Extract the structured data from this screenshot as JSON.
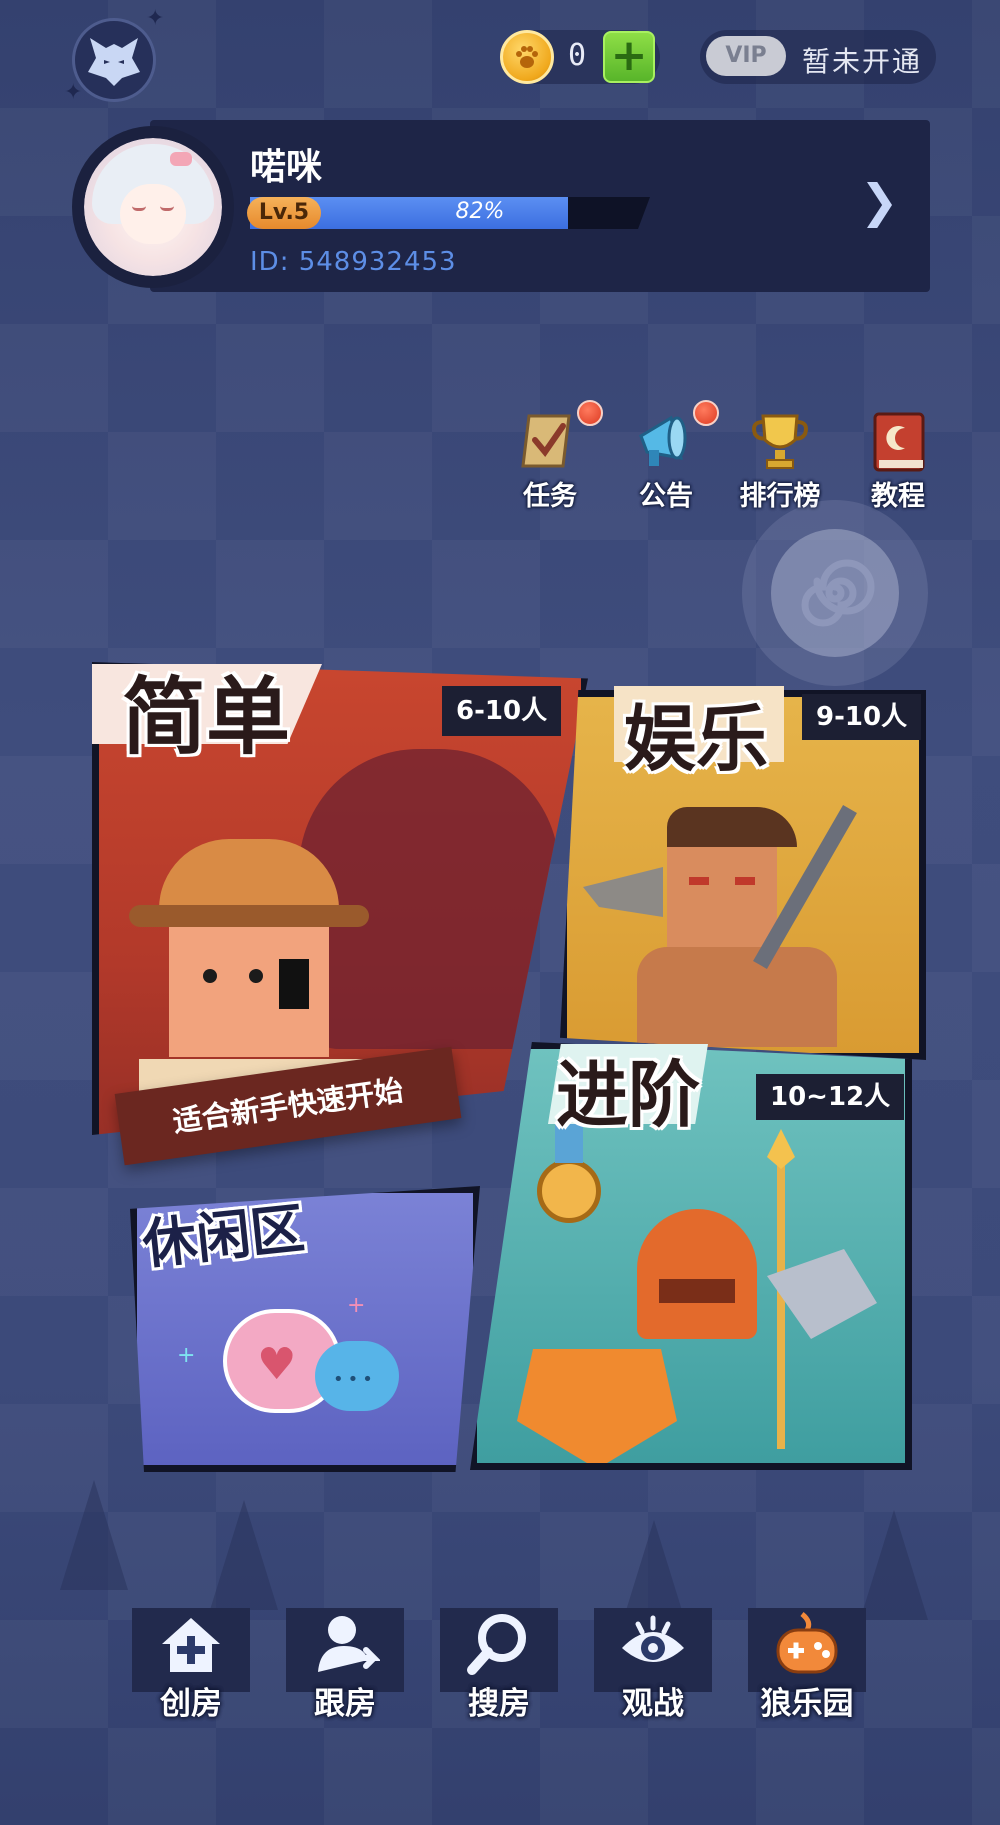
{
  "top_bar": {
    "logo_icon": "wolf-logo-icon",
    "coin_icon": "paw-coin-icon",
    "coin_value": "0",
    "add_coin_icon": "plus-icon",
    "vip_label": "VIP",
    "vip_status": "暂未开通"
  },
  "profile": {
    "avatar_icon": "avatar-image",
    "name": "喏咪",
    "level": "Lv.5",
    "xp_percent": 82,
    "xp_text": "82%",
    "user_id": "ID: 548932453",
    "arrow_icon": "chevron-right-icon"
  },
  "quick_actions": [
    {
      "label": "任务",
      "icon": "scroll-check-icon",
      "has_badge": true
    },
    {
      "label": "公告",
      "icon": "megaphone-icon",
      "has_badge": true
    },
    {
      "label": "排行榜",
      "icon": "trophy-icon",
      "has_badge": false
    },
    {
      "label": "教程",
      "icon": "book-icon",
      "has_badge": false
    }
  ],
  "spiral_icon": "spiral-icon",
  "modes": {
    "easy": {
      "title": "简单",
      "players": "6-10人",
      "subtitle": "适合新手快速开始"
    },
    "fun": {
      "title": "娱乐",
      "players": "9-10人"
    },
    "advanced": {
      "title": "进阶",
      "players": "10~12人"
    },
    "casual": {
      "title": "休闲区"
    }
  },
  "bottom_nav": [
    {
      "label": "创房",
      "icon": "house-plus-icon"
    },
    {
      "label": "跟房",
      "icon": "follow-user-icon"
    },
    {
      "label": "搜房",
      "icon": "magnifier-icon"
    },
    {
      "label": "观战",
      "icon": "eye-icon"
    },
    {
      "label": "狼乐园",
      "icon": "gamepad-icon"
    }
  ],
  "colors": {
    "background": "#3b4877",
    "panel": "#1e2547",
    "xp_bar": "#3c6fe0",
    "level_badge": "#e6892c",
    "coin_add": "#58b52a",
    "badge_red": "#dc3a22"
  }
}
